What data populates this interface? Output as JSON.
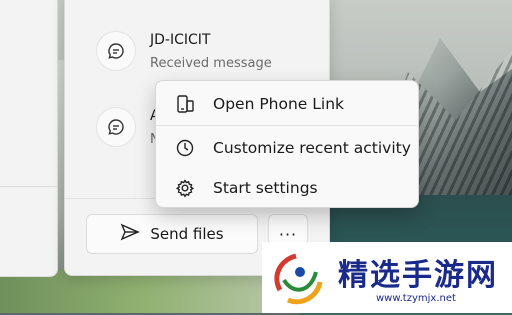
{
  "notifications": [
    {
      "title": "JD-ICICIT",
      "subtitle": "Received message"
    },
    {
      "title": "A",
      "subtitle": "N"
    }
  ],
  "context_menu": {
    "items": [
      {
        "label": "Open Phone Link",
        "icon": "phone-link-icon"
      },
      {
        "label": "Customize recent activity",
        "icon": "clock-icon"
      },
      {
        "label": "Start settings",
        "icon": "gear-icon"
      }
    ]
  },
  "actions": {
    "send_files_label": "Send files",
    "more_label": "···"
  },
  "watermark": {
    "brand": "精选手游网",
    "url": "www.tzymjx.net"
  }
}
